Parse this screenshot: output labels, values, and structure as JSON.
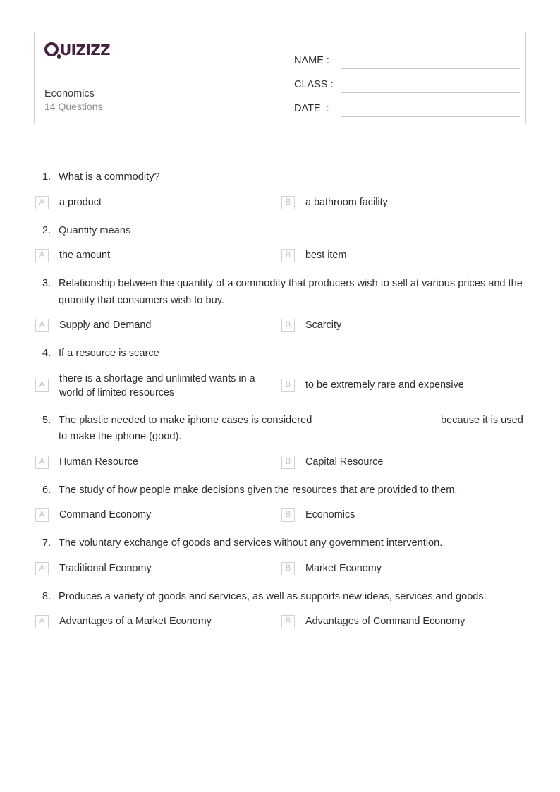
{
  "header": {
    "logo_name": "quizizz-logo",
    "logo_text": "UIZIZZ",
    "logo_color": "#46213f",
    "quiz_title": "Economics",
    "question_count_label": "14 Questions",
    "fields": [
      {
        "label": "NAME :",
        "value": ""
      },
      {
        "label": "CLASS :",
        "value": ""
      },
      {
        "label": "DATE  :",
        "value": ""
      }
    ]
  },
  "questions": [
    {
      "number": "1.",
      "text": "What is a commodity?",
      "options": [
        {
          "letter": "A",
          "text": "a product"
        },
        {
          "letter": "B",
          "text": "a bathroom facility"
        }
      ]
    },
    {
      "number": "2.",
      "text": "Quantity means",
      "options": [
        {
          "letter": "A",
          "text": "the amount"
        },
        {
          "letter": "B",
          "text": "best item"
        }
      ]
    },
    {
      "number": "3.",
      "text": "Relationship between the quantity of a commodity that producers wish to sell at various prices and the quantity that consumers wish to buy.",
      "options": [
        {
          "letter": "A",
          "text": "Supply and Demand"
        },
        {
          "letter": "B",
          "text": "Scarcity"
        }
      ]
    },
    {
      "number": "4.",
      "text": "If a resource is scarce",
      "options": [
        {
          "letter": "A",
          "text": "there is a shortage and unlimited wants in a world of limited resources"
        },
        {
          "letter": "B",
          "text": "to be extremely rare and expensive"
        }
      ]
    },
    {
      "number": "5.",
      "text": "The plastic needed to make iphone cases is considered ___________ __________ because it is used to make the iphone (good).",
      "options": [
        {
          "letter": "A",
          "text": "Human Resource"
        },
        {
          "letter": "B",
          "text": "Capital Resource"
        }
      ]
    },
    {
      "number": "6.",
      "text": "The study of how people make decisions given the resources that are provided to them.",
      "options": [
        {
          "letter": "A",
          "text": "Command Economy"
        },
        {
          "letter": "B",
          "text": "Economics"
        }
      ]
    },
    {
      "number": "7.",
      "text": "The voluntary exchange of goods and services without any government intervention.",
      "options": [
        {
          "letter": "A",
          "text": "Traditional Economy"
        },
        {
          "letter": "B",
          "text": "Market Economy"
        }
      ]
    },
    {
      "number": "8.",
      "text": "Produces a variety of goods and services, as well as supports new ideas, services and goods.",
      "options": [
        {
          "letter": "A",
          "text": "Advantages of a Market Economy"
        },
        {
          "letter": "B",
          "text": "Advantages of Command Economy"
        }
      ]
    }
  ]
}
